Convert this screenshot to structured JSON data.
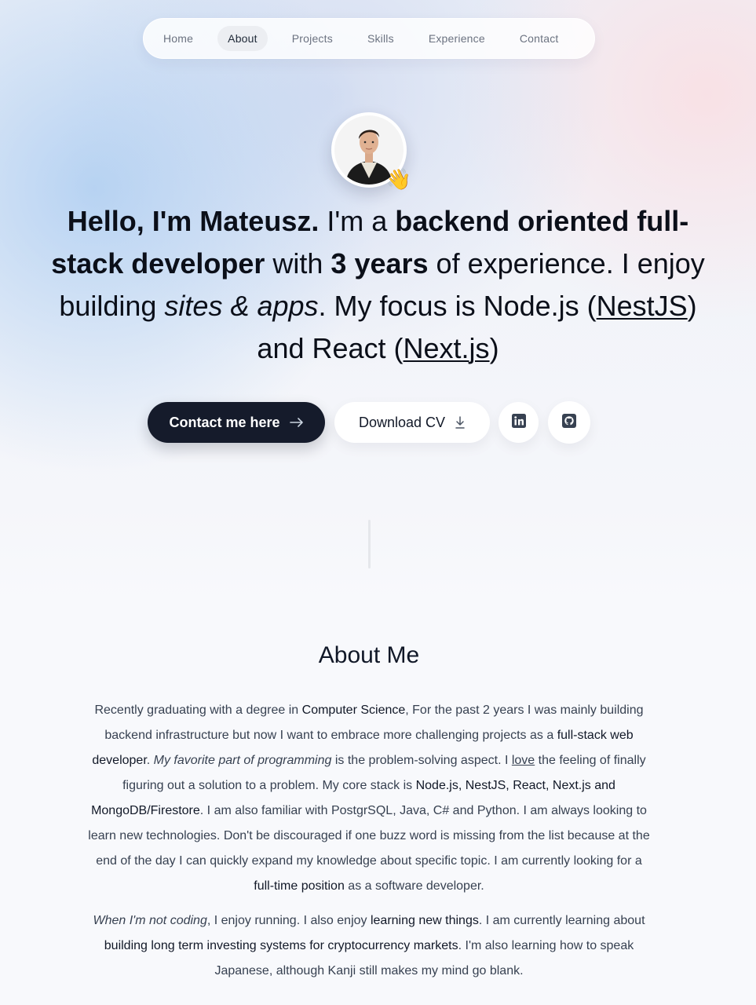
{
  "nav": {
    "items": [
      {
        "label": "Home"
      },
      {
        "label": "About"
      },
      {
        "label": "Projects"
      },
      {
        "label": "Skills"
      },
      {
        "label": "Experience"
      },
      {
        "label": "Contact"
      }
    ],
    "active_index": 1
  },
  "avatar": {
    "emoji": "👋"
  },
  "hero": {
    "greeting": "Hello, I'm Mateusz.",
    "t1": " I'm a ",
    "b1": "backend oriented full-stack developer",
    "t2": " with ",
    "b2": "3 years",
    "t3": " of experience. I enjoy building ",
    "i1": "sites & apps",
    "t4": ". My focus is Node.js (",
    "link1": "NestJS",
    "t5": ") and React (",
    "link2": "Next.js",
    "t6": ")"
  },
  "actions": {
    "contact_label": "Contact me here",
    "cv_label": "Download CV",
    "linkedin_icon": "linkedin-icon",
    "github_icon": "github-icon"
  },
  "about": {
    "title": "About Me",
    "p1": {
      "a": "Recently graduating with a degree in ",
      "b": "Computer Science",
      "c": ", For the past 2 years I was mainly building backend infrastructure but now I want to embrace more challenging projects as a ",
      "d": "full-stack web developer",
      "e": ". ",
      "f": "My favorite part of programming",
      "g": " is the problem-solving aspect. I ",
      "h": "love",
      "i": " the feeling of finally figuring out a solution to a problem. My core stack is ",
      "j": "Node.js, NestJS, React, Next.js and MongoDB/Firestore",
      "k": ". I am also familiar with PostgrSQL, Java, C# and Python. I am always looking to learn new technologies. Don't be discouraged if one buzz word is missing from the list because at the end of the day I can quickly expand my knowledge about specific topic. I am currently looking for a ",
      "l": "full-time position",
      "m": " as a software developer."
    },
    "p2": {
      "a": "When I'm not coding",
      "b": ", I enjoy running. I also enjoy ",
      "c": "learning new things",
      "d": ". I am currently learning about ",
      "e": "building long term investing systems for cryptocurrency markets",
      "f": ". I'm also learning how to speak Japanese, although Kanji still makes my mind go blank."
    }
  },
  "colors": {
    "dark_button": "#151b2b",
    "text": "#111827",
    "muted": "#6b7280"
  }
}
